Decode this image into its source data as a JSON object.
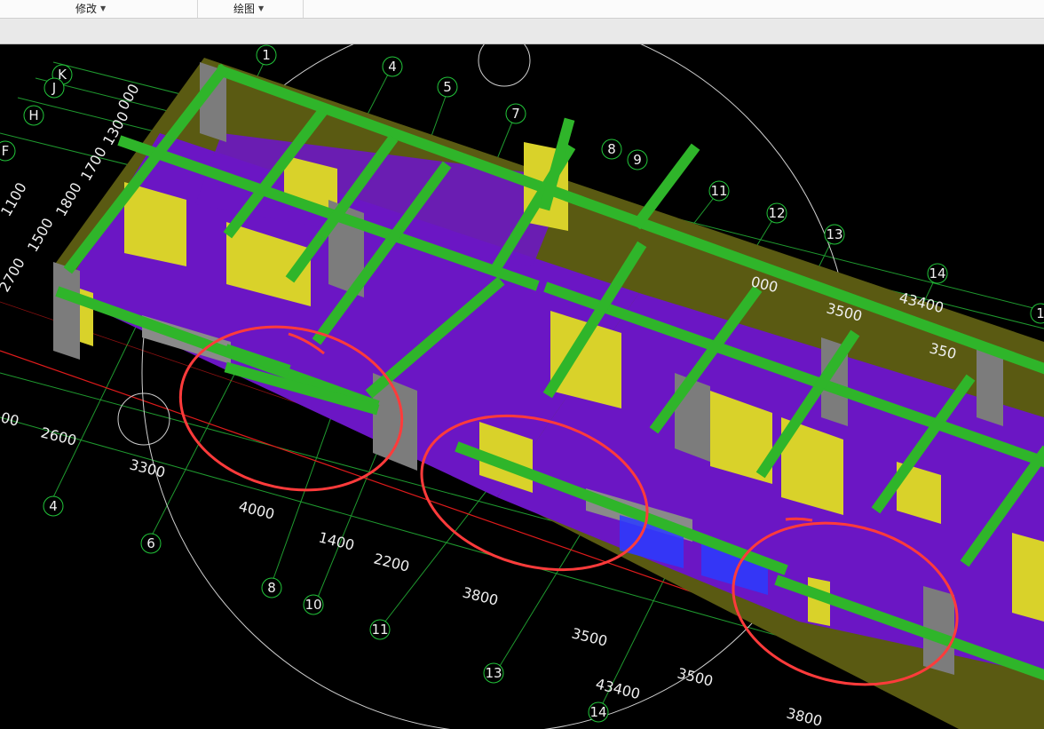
{
  "toolbar": {
    "modify_label": "修改",
    "draw_label": "绘图"
  },
  "axis_bubbles": [
    {
      "label": "1"
    },
    {
      "label": "4"
    },
    {
      "label": "5"
    },
    {
      "label": "7"
    },
    {
      "label": "8"
    },
    {
      "label": "9"
    },
    {
      "label": "11"
    },
    {
      "label": "12"
    },
    {
      "label": "13"
    },
    {
      "label": "14"
    },
    {
      "label": "1"
    },
    {
      "label": "K"
    },
    {
      "label": "J"
    },
    {
      "label": "H"
    },
    {
      "label": "F"
    },
    {
      "label": "4"
    },
    {
      "label": "6"
    },
    {
      "label": "8"
    },
    {
      "label": "10"
    },
    {
      "label": "11"
    },
    {
      "label": "13"
    },
    {
      "label": "14"
    }
  ],
  "dimensions_back": [
    "000",
    "1300",
    "1700",
    "1800",
    "1500",
    "1100",
    "2700",
    "000",
    "3500",
    "43400",
    "350"
  ],
  "dimensions_front": [
    "00",
    "2600",
    "3300",
    "4000",
    "1400",
    "2200",
    "3800",
    "3500",
    "3500",
    "43400",
    "3800"
  ],
  "colors": {
    "beam": "#2fb52a",
    "wall": "#d9d22a",
    "slab": "#6b16c4",
    "column": "#7c7c7c",
    "grid_line": "#1f9a2f",
    "red_axis": "#e01b1b",
    "annotation": "#ff3b3b",
    "window": "#2a3cff"
  }
}
